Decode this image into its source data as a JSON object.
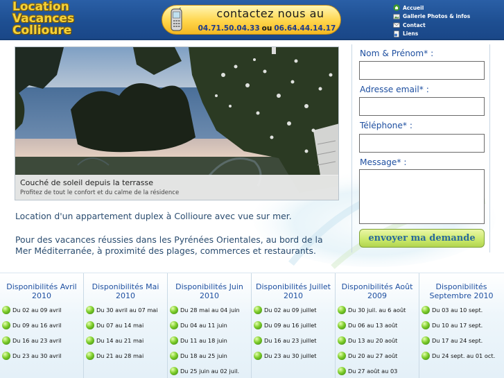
{
  "header": {
    "logo_lines": [
      "Location",
      "Vacances",
      "Collioure"
    ],
    "contact": {
      "title": "contactez nous au",
      "phone1": "04.71.50.04.33",
      "separator": "ou",
      "phone2": "06.64.44.14.17"
    },
    "nav": [
      {
        "label": "Accueil",
        "icon": "home-icon"
      },
      {
        "label": "Gallerie Photos & infos",
        "icon": "photos-icon"
      },
      {
        "label": "Contact",
        "icon": "mail-icon"
      },
      {
        "label": "Liens",
        "icon": "links-icon"
      }
    ]
  },
  "hero": {
    "caption_title": "Couché de soleil depuis la terrasse",
    "caption_subtitle": "Profitez de tout le confort et du calme de la résidence"
  },
  "intro": {
    "paragraph1": "Location d'un appartement duplex à Collioure avec vue sur mer.",
    "paragraph2": "Pour des vacances réussies dans les Pyrénées Orientales, au bord de la Mer Méditerranée, à proximité des plages, commerces et restaurants."
  },
  "form": {
    "name_label": "Nom & Prénom* :",
    "email_label": "Adresse email* :",
    "phone_label": "Téléphone* :",
    "message_label": "Message* :",
    "submit_label": "envoyer ma demande"
  },
  "availability": [
    {
      "title": "Disponibilités Avril 2010",
      "slots": [
        "Du 02 au 09 avril",
        "Du 09 au 16 avril",
        "Du 16 au 23 avril",
        "Du 23 au 30 avril"
      ]
    },
    {
      "title": "Disponibilités Mai 2010",
      "slots": [
        "Du 30 avril au 07 mai",
        "Du 07 au 14 mai",
        "Du 14 au 21 mai",
        "Du 21 au 28 mai"
      ]
    },
    {
      "title": "Disponibilités Juin 2010",
      "slots": [
        "Du 28 mai au 04 juin",
        "Du 04 au 11 juin",
        "Du 11 au 18 juin",
        "Du 18 au 25 juin",
        "Du 25 juin au 02 juil."
      ]
    },
    {
      "title": "Disponibilités Juillet 2010",
      "slots": [
        "Du 02 au 09 juillet",
        "Du 09 au 16 juillet",
        "Du 16 au 23 juillet",
        "Du 23 au 30 juillet"
      ]
    },
    {
      "title": "Disponibilités Août 2009",
      "slots": [
        "Du 30 juil. au 6 août",
        "Du 06 au 13 août",
        "Du 13 au 20 août",
        "Du 20 au 27 août",
        "Du 27 août au 03"
      ]
    },
    {
      "title": "Disponibilités Septembre 2010",
      "slots": [
        "Du 03 au 10 sept.",
        "Du 10 au 17 sept.",
        "Du 17 au 24 sept.",
        "Du 24 sept. au 01 oct."
      ]
    }
  ]
}
